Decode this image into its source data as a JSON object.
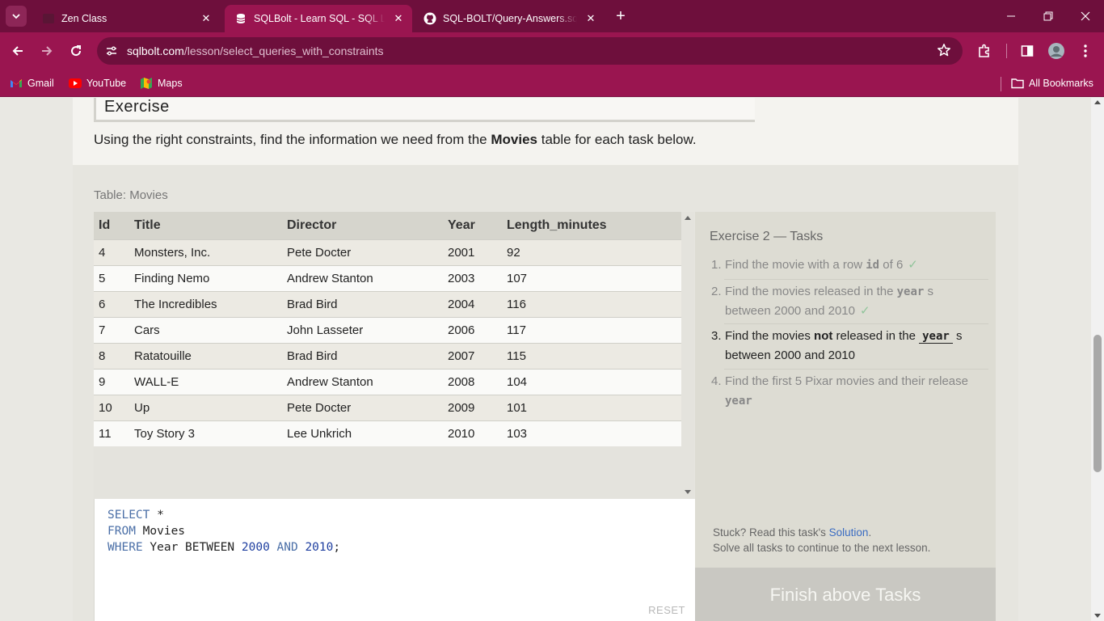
{
  "browser": {
    "tabs": [
      {
        "title": "Zen Class",
        "active": false
      },
      {
        "title": "SQLBolt - Learn SQL - SQL Lesson",
        "active": true
      },
      {
        "title": "SQL-BOLT/Query-Answers.sql at",
        "active": false
      }
    ],
    "url_host": "sqlbolt.com",
    "url_path": "/lesson/select_queries_with_constraints",
    "bookmarks": [
      "Gmail",
      "YouTube",
      "Maps"
    ],
    "all_bookmarks": "All Bookmarks",
    "colors": {
      "frame": "#6e0f3c",
      "toolbar": "#9a1550"
    }
  },
  "exercise": {
    "heading": "Exercise",
    "intro_before": "Using the right constraints, find the information we need from the ",
    "intro_bold": "Movies",
    "intro_after": " table for each task below."
  },
  "table": {
    "caption": "Table: Movies",
    "columns": [
      "Id",
      "Title",
      "Director",
      "Year",
      "Length_minutes"
    ],
    "rows": [
      [
        "4",
        "Monsters, Inc.",
        "Pete Docter",
        "2001",
        "92"
      ],
      [
        "5",
        "Finding Nemo",
        "Andrew Stanton",
        "2003",
        "107"
      ],
      [
        "6",
        "The Incredibles",
        "Brad Bird",
        "2004",
        "116"
      ],
      [
        "7",
        "Cars",
        "John Lasseter",
        "2006",
        "117"
      ],
      [
        "8",
        "Ratatouille",
        "Brad Bird",
        "2007",
        "115"
      ],
      [
        "9",
        "WALL-E",
        "Andrew Stanton",
        "2008",
        "104"
      ],
      [
        "10",
        "Up",
        "Pete Docter",
        "2009",
        "101"
      ],
      [
        "11",
        "Toy Story 3",
        "Lee Unkrich",
        "2010",
        "103"
      ]
    ]
  },
  "editor": {
    "line1_kw": "SELECT",
    "line1_rest": " *",
    "line2_kw": "FROM",
    "line2_rest": " Movies",
    "line3_kw": "WHERE",
    "line3_a": " Year BETWEEN ",
    "line3_n1": "2000",
    "line3_and": " AND ",
    "line3_n2": "2010",
    "line3_end": ";",
    "reset_label": "RESET"
  },
  "tasks": {
    "title": "Exercise 2 — Tasks",
    "items": [
      {
        "num": "1.",
        "a": "Find the movie with a row ",
        "code": "id",
        "b": " of 6",
        "c": "",
        "d": "",
        "tick": "✓",
        "status": "done"
      },
      {
        "num": "2.",
        "a": "Find the movies released in the ",
        "code": "year",
        "b": "s",
        "c": "between 2000 and 2010",
        "d": "",
        "tick": "✓",
        "status": "done"
      },
      {
        "num": "3.",
        "a": "Find the movies ",
        "bold": "not",
        "a2": " released in the ",
        "code": "year",
        "b": "s",
        "c": "between 2000 and 2010",
        "status": "current"
      },
      {
        "num": "4.",
        "a": "Find the first 5 Pixar movies and their release",
        "code": "year",
        "status": "pending"
      }
    ],
    "stuck_text": "Stuck? Read this task's ",
    "solution_link": "Solution",
    "stuck_end": ".",
    "continue_text": "Solve all tasks to continue to the next lesson.",
    "finish_label": "Finish above Tasks"
  }
}
